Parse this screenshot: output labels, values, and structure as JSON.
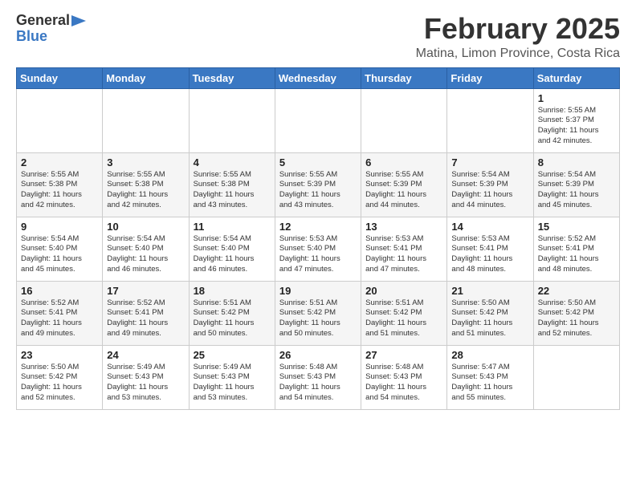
{
  "logo": {
    "line1": "General",
    "line2": "Blue"
  },
  "title": "February 2025",
  "subtitle": "Matina, Limon Province, Costa Rica",
  "weekdays": [
    "Sunday",
    "Monday",
    "Tuesday",
    "Wednesday",
    "Thursday",
    "Friday",
    "Saturday"
  ],
  "weeks": [
    [
      {
        "day": "",
        "info": ""
      },
      {
        "day": "",
        "info": ""
      },
      {
        "day": "",
        "info": ""
      },
      {
        "day": "",
        "info": ""
      },
      {
        "day": "",
        "info": ""
      },
      {
        "day": "",
        "info": ""
      },
      {
        "day": "1",
        "info": "Sunrise: 5:55 AM\nSunset: 5:37 PM\nDaylight: 11 hours\nand 42 minutes."
      }
    ],
    [
      {
        "day": "2",
        "info": "Sunrise: 5:55 AM\nSunset: 5:38 PM\nDaylight: 11 hours\nand 42 minutes."
      },
      {
        "day": "3",
        "info": "Sunrise: 5:55 AM\nSunset: 5:38 PM\nDaylight: 11 hours\nand 42 minutes."
      },
      {
        "day": "4",
        "info": "Sunrise: 5:55 AM\nSunset: 5:38 PM\nDaylight: 11 hours\nand 43 minutes."
      },
      {
        "day": "5",
        "info": "Sunrise: 5:55 AM\nSunset: 5:39 PM\nDaylight: 11 hours\nand 43 minutes."
      },
      {
        "day": "6",
        "info": "Sunrise: 5:55 AM\nSunset: 5:39 PM\nDaylight: 11 hours\nand 44 minutes."
      },
      {
        "day": "7",
        "info": "Sunrise: 5:54 AM\nSunset: 5:39 PM\nDaylight: 11 hours\nand 44 minutes."
      },
      {
        "day": "8",
        "info": "Sunrise: 5:54 AM\nSunset: 5:39 PM\nDaylight: 11 hours\nand 45 minutes."
      }
    ],
    [
      {
        "day": "9",
        "info": "Sunrise: 5:54 AM\nSunset: 5:40 PM\nDaylight: 11 hours\nand 45 minutes."
      },
      {
        "day": "10",
        "info": "Sunrise: 5:54 AM\nSunset: 5:40 PM\nDaylight: 11 hours\nand 46 minutes."
      },
      {
        "day": "11",
        "info": "Sunrise: 5:54 AM\nSunset: 5:40 PM\nDaylight: 11 hours\nand 46 minutes."
      },
      {
        "day": "12",
        "info": "Sunrise: 5:53 AM\nSunset: 5:40 PM\nDaylight: 11 hours\nand 47 minutes."
      },
      {
        "day": "13",
        "info": "Sunrise: 5:53 AM\nSunset: 5:41 PM\nDaylight: 11 hours\nand 47 minutes."
      },
      {
        "day": "14",
        "info": "Sunrise: 5:53 AM\nSunset: 5:41 PM\nDaylight: 11 hours\nand 48 minutes."
      },
      {
        "day": "15",
        "info": "Sunrise: 5:52 AM\nSunset: 5:41 PM\nDaylight: 11 hours\nand 48 minutes."
      }
    ],
    [
      {
        "day": "16",
        "info": "Sunrise: 5:52 AM\nSunset: 5:41 PM\nDaylight: 11 hours\nand 49 minutes."
      },
      {
        "day": "17",
        "info": "Sunrise: 5:52 AM\nSunset: 5:41 PM\nDaylight: 11 hours\nand 49 minutes."
      },
      {
        "day": "18",
        "info": "Sunrise: 5:51 AM\nSunset: 5:42 PM\nDaylight: 11 hours\nand 50 minutes."
      },
      {
        "day": "19",
        "info": "Sunrise: 5:51 AM\nSunset: 5:42 PM\nDaylight: 11 hours\nand 50 minutes."
      },
      {
        "day": "20",
        "info": "Sunrise: 5:51 AM\nSunset: 5:42 PM\nDaylight: 11 hours\nand 51 minutes."
      },
      {
        "day": "21",
        "info": "Sunrise: 5:50 AM\nSunset: 5:42 PM\nDaylight: 11 hours\nand 51 minutes."
      },
      {
        "day": "22",
        "info": "Sunrise: 5:50 AM\nSunset: 5:42 PM\nDaylight: 11 hours\nand 52 minutes."
      }
    ],
    [
      {
        "day": "23",
        "info": "Sunrise: 5:50 AM\nSunset: 5:42 PM\nDaylight: 11 hours\nand 52 minutes."
      },
      {
        "day": "24",
        "info": "Sunrise: 5:49 AM\nSunset: 5:43 PM\nDaylight: 11 hours\nand 53 minutes."
      },
      {
        "day": "25",
        "info": "Sunrise: 5:49 AM\nSunset: 5:43 PM\nDaylight: 11 hours\nand 53 minutes."
      },
      {
        "day": "26",
        "info": "Sunrise: 5:48 AM\nSunset: 5:43 PM\nDaylight: 11 hours\nand 54 minutes."
      },
      {
        "day": "27",
        "info": "Sunrise: 5:48 AM\nSunset: 5:43 PM\nDaylight: 11 hours\nand 54 minutes."
      },
      {
        "day": "28",
        "info": "Sunrise: 5:47 AM\nSunset: 5:43 PM\nDaylight: 11 hours\nand 55 minutes."
      },
      {
        "day": "",
        "info": ""
      }
    ]
  ]
}
